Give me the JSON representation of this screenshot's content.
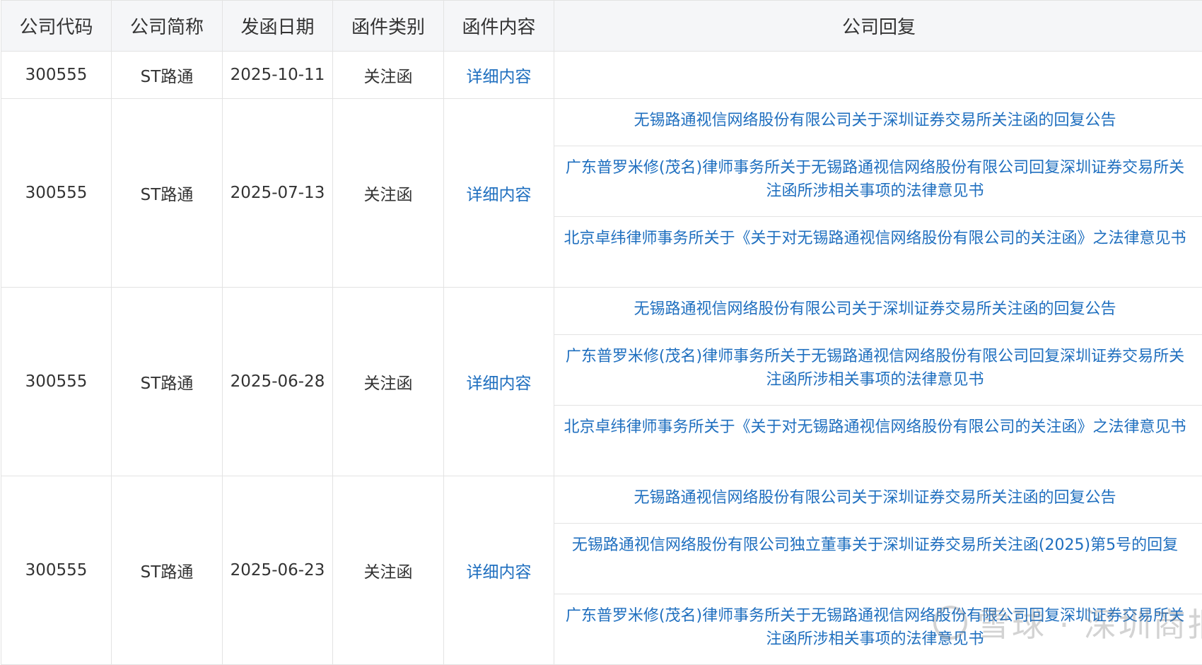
{
  "header": {
    "code": "公司代码",
    "name": "公司简称",
    "date": "发函日期",
    "type": "函件类别",
    "content": "函件内容",
    "reply": "公司回复"
  },
  "rows": [
    {
      "code": "300555",
      "name": "ST路通",
      "date": "2025-10-11",
      "type": "关注函",
      "content": "详细内容",
      "replies": []
    },
    {
      "code": "300555",
      "name": "ST路通",
      "date": "2025-07-13",
      "type": "关注函",
      "content": "详细内容",
      "replies": [
        "无锡路通视信网络股份有限公司关于深圳证券交易所关注函的回复公告",
        "广东普罗米修(茂名)律师事务所关于无锡路通视信网络股份有限公司回复深圳证券交易所关注函所涉相关事项的法律意见书",
        "北京卓纬律师事务所关于《关于对无锡路通视信网络股份有限公司的关注函》之法律意见书"
      ]
    },
    {
      "code": "300555",
      "name": "ST路通",
      "date": "2025-06-28",
      "type": "关注函",
      "content": "详细内容",
      "replies": [
        "无锡路通视信网络股份有限公司关于深圳证券交易所关注函的回复公告",
        "广东普罗米修(茂名)律师事务所关于无锡路通视信网络股份有限公司回复深圳证券交易所关注函所涉相关事项的法律意见书",
        "北京卓纬律师事务所关于《关于对无锡路通视信网络股份有限公司的关注函》之法律意见书"
      ]
    },
    {
      "code": "300555",
      "name": "ST路通",
      "date": "2025-06-23",
      "type": "关注函",
      "content": "详细内容",
      "replies": [
        "无锡路通视信网络股份有限公司关于深圳证券交易所关注函的回复公告",
        "无锡路通视信网络股份有限公司独立董事关于深圳证券交易所关注函(2025)第5号的回复",
        "广东普罗米修(茂名)律师事务所关于无锡路通视信网络股份有限公司回复深圳证券交易所关注函所涉相关事项的法律意见书"
      ]
    }
  ],
  "watermark": "雪球 · 深圳商报"
}
